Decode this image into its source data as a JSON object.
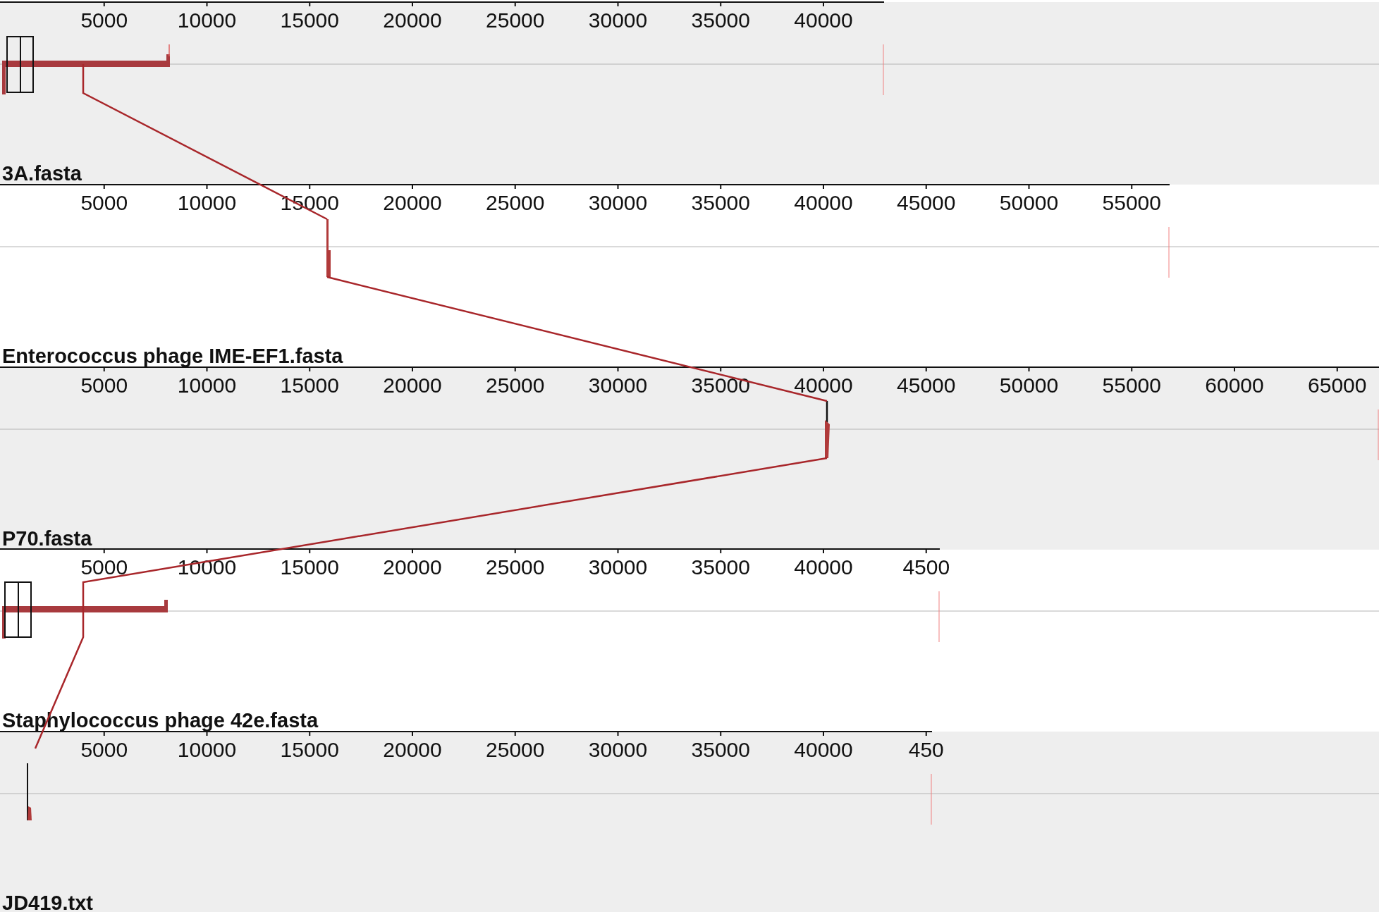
{
  "genomes": [
    {
      "name": "3A.fasta",
      "ticks": [
        "5000",
        "10000",
        "15000",
        "20000",
        "25000",
        "30000",
        "35000",
        "40000"
      ]
    },
    {
      "name": "Enterococcus phage IME-EF1.fasta",
      "ticks": [
        "5000",
        "10000",
        "15000",
        "20000",
        "25000",
        "30000",
        "35000",
        "40000",
        "45000",
        "50000",
        "55000"
      ]
    },
    {
      "name": "P70.fasta",
      "ticks": [
        "5000",
        "10000",
        "15000",
        "20000",
        "25000",
        "30000",
        "35000",
        "40000",
        "45000",
        "50000",
        "55000",
        "60000",
        "65000"
      ]
    },
    {
      "name": "Staphylococcus phage 42e.fasta",
      "ticks": [
        "5000",
        "10000",
        "15000",
        "20000",
        "25000",
        "30000",
        "35000",
        "40000",
        "4500"
      ]
    },
    {
      "name": "JD419.txt",
      "ticks": [
        "5000",
        "10000",
        "15000",
        "20000",
        "25000",
        "30000",
        "35000",
        "40000",
        "450"
      ]
    }
  ]
}
